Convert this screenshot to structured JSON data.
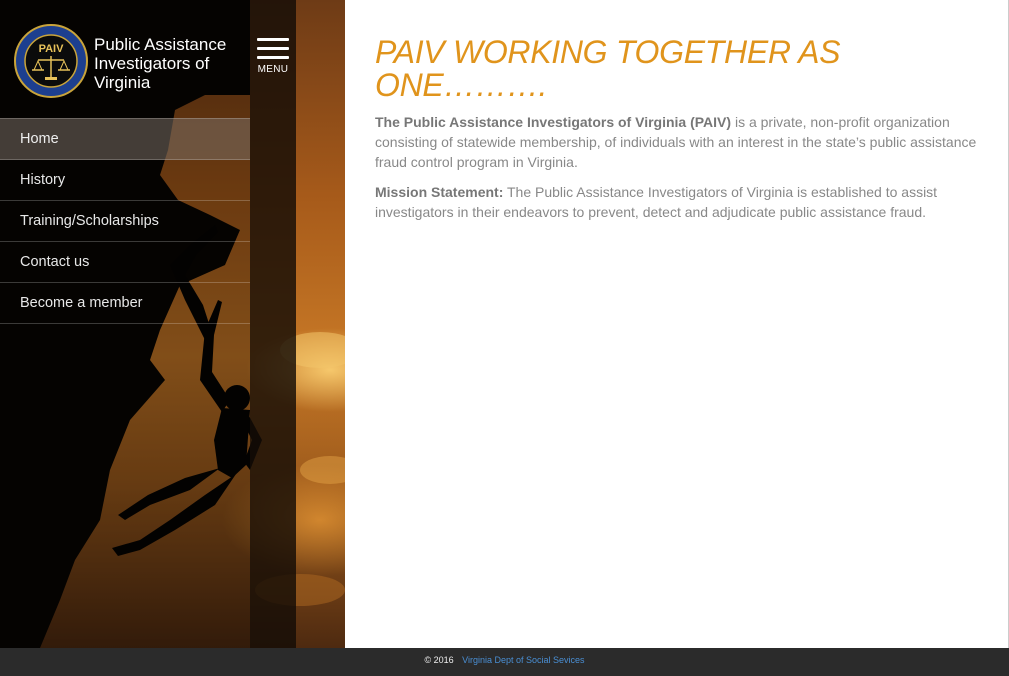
{
  "brand": {
    "logo_text": "PAIV",
    "logo_ring_text": "PUBLIC ASSISTANCE INVESTIGATORS OF VIRGINIA",
    "title_line1": "Public Assistance",
    "title_line2": "Investigators of",
    "title_line3": "Virginia"
  },
  "menu": {
    "label": "MENU"
  },
  "nav": {
    "items": [
      {
        "label": "Home",
        "active": true
      },
      {
        "label": "History"
      },
      {
        "label": "Training/Scholarships"
      },
      {
        "label": "Contact us"
      },
      {
        "label": "Become a member"
      }
    ]
  },
  "main": {
    "headline": "PAIV WORKING TOGETHER AS ONE……….",
    "intro_bold": "The Public Assistance Investigators of Virginia (PAIV)",
    "intro_rest": " is a private, non-profit organization consisting of statewide membership, of individuals with an interest in the state’s public assistance fraud control program in Virginia.",
    "mission_bold": "Mission Statement:",
    "mission_rest": "  The Public Assistance Investigators of Virginia is established to assist investigators in their endeavors to prevent, detect and adjudicate public assistance fraud."
  },
  "footer": {
    "copyright": "© 2016",
    "link": "Virginia Dept of Social Sevices"
  },
  "colors": {
    "accent": "#e0941c",
    "footer_bg": "#2b2b2b",
    "footer_link": "#4a8fd4"
  }
}
